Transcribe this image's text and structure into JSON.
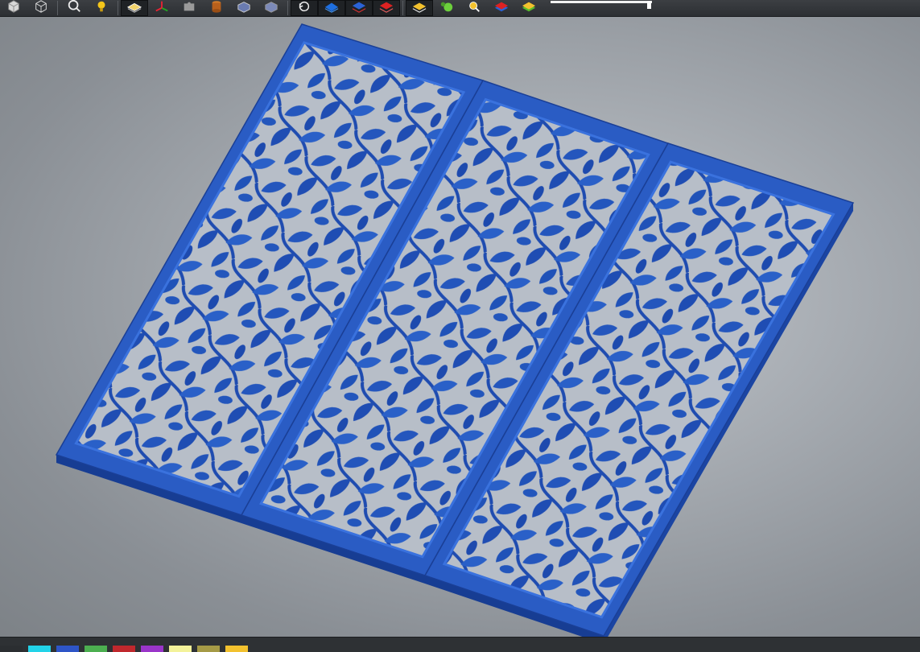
{
  "toolbar": {
    "buttons": [
      {
        "name": "solid-view-icon",
        "active": false
      },
      {
        "name": "wireframe-view-icon",
        "active": false
      },
      {
        "name": "zoom-icon",
        "active": false
      },
      {
        "name": "lightbulb-icon",
        "active": false
      },
      {
        "name": "layer-plate-icon",
        "active": true
      },
      {
        "name": "axes-icon",
        "active": false
      },
      {
        "name": "puzzle-icon",
        "active": false
      },
      {
        "name": "cylinder-icon",
        "active": false
      },
      {
        "name": "box-view-icon",
        "active": false
      },
      {
        "name": "box-shaded-icon",
        "active": false
      },
      {
        "name": "rotate-reset-icon",
        "active": true
      },
      {
        "name": "blue-layer-icon",
        "active": true
      },
      {
        "name": "red-blue-layers-icon",
        "active": true
      },
      {
        "name": "red-layer-icon",
        "active": true
      },
      {
        "name": "gold-layer-icon",
        "active": true
      },
      {
        "name": "green-blob-icon",
        "active": false
      },
      {
        "name": "inspect-icon",
        "active": false
      },
      {
        "name": "stack-icon",
        "active": false
      },
      {
        "name": "stack-green-icon",
        "active": false
      }
    ],
    "slider": {
      "value": 0.97
    }
  },
  "viewport": {
    "model_color": "#2a5cc4",
    "panel_count": 3
  },
  "palette": {
    "colors": [
      "#2b2e31",
      "#22d3e8",
      "#2e55c7",
      "#4caf50",
      "#c0282d",
      "#9a35c9",
      "#f3f29a",
      "#a59a46",
      "#f2c12e"
    ]
  }
}
